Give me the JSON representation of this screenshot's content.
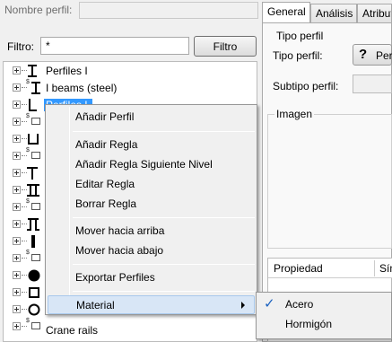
{
  "header": {
    "name_label": "Nombre perfil:",
    "name_value": ""
  },
  "filter": {
    "label": "Filtro:",
    "value": "*",
    "button_label": "Filtro"
  },
  "tree": [
    {
      "label": "Perfiles I",
      "icon": "i-beam-icon"
    },
    {
      "label": "I beams (steel)",
      "icon": "i-beam-icon"
    },
    {
      "label": "Perfiles L",
      "icon": "l-angle-icon",
      "selected": true
    },
    {
      "label": "",
      "icon": "folder-icon"
    },
    {
      "label": "",
      "icon": "u-channel-icon"
    },
    {
      "label": "",
      "icon": "folder-icon"
    },
    {
      "label": "",
      "icon": "t-section-icon"
    },
    {
      "label": "",
      "icon": "double-i-icon"
    },
    {
      "label": "",
      "icon": "folder-icon"
    },
    {
      "label": "",
      "icon": "pi-section-icon"
    },
    {
      "label": "",
      "icon": "flat-bar-icon"
    },
    {
      "label": "",
      "icon": "folder-icon"
    },
    {
      "label": "",
      "icon": "round-bar-icon"
    },
    {
      "label": "",
      "icon": "square-tube-icon"
    },
    {
      "label": "",
      "icon": "round-tube-icon"
    },
    {
      "label": "",
      "icon": "folder-icon"
    },
    {
      "label": "Crane rails",
      "icon": "folder-icon"
    },
    {
      "label": "",
      "icon": "folder-icon"
    }
  ],
  "tabs": [
    {
      "label": "General",
      "active": true
    },
    {
      "label": "Análisis"
    },
    {
      "label": "Atribut"
    }
  ],
  "general": {
    "group_label": "Tipo perfil",
    "tipo_label": "Tipo perfil:",
    "tipo_value": "Perf",
    "subtipo_label": "Subtipo perfil:",
    "imagen_label": "Imagen"
  },
  "properties": {
    "col1": "Propiedad",
    "col2": "Sím"
  },
  "context_menu": {
    "items": [
      {
        "label": "Añadir Perfil"
      },
      {
        "label": "Añadir Regla"
      },
      {
        "label": "Añadir Regla Siguiente Nivel"
      },
      {
        "label": "Editar Regla"
      },
      {
        "label": "Borrar Regla"
      },
      {
        "label": "Mover hacia arriba"
      },
      {
        "label": "Mover hacia abajo"
      },
      {
        "label": "Exportar Perfiles"
      },
      {
        "label": "Material",
        "submenu": true,
        "highlighted": true
      }
    ],
    "submenu": [
      {
        "label": "Acero",
        "checked": true
      },
      {
        "label": "Hormigón"
      }
    ]
  }
}
